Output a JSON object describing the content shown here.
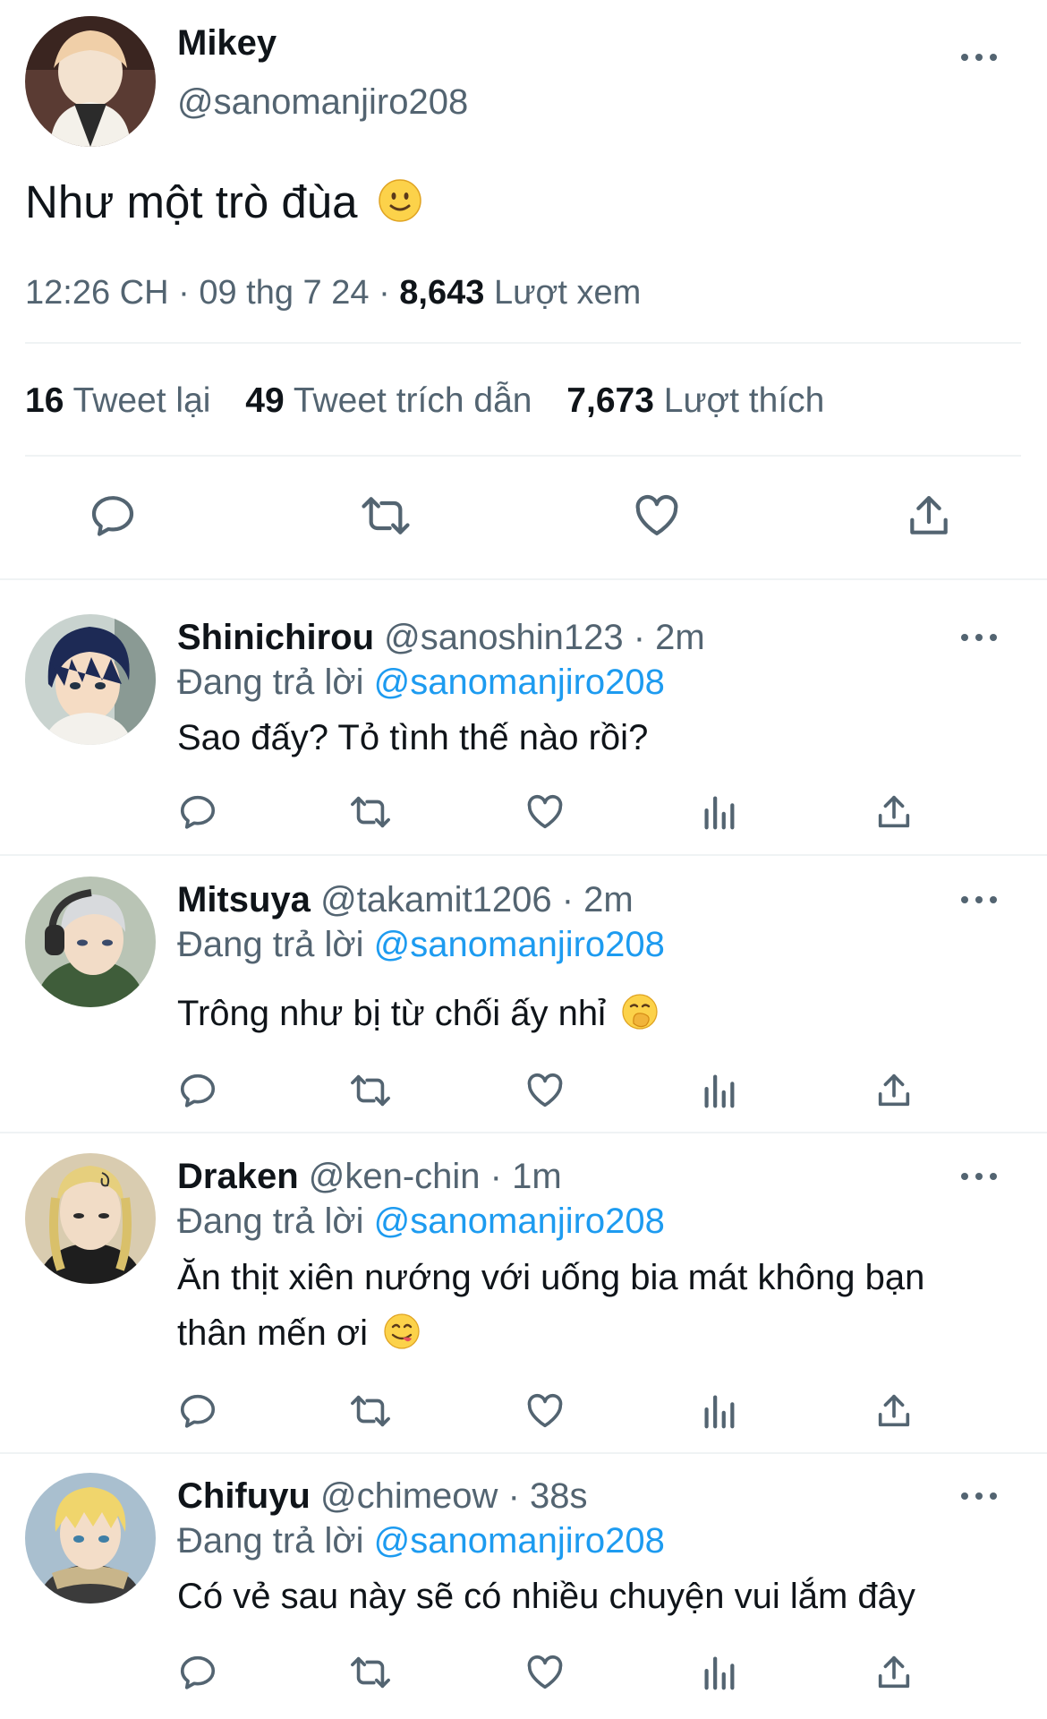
{
  "main_tweet": {
    "display_name": "Mikey",
    "handle": "@sanomanjiro208",
    "text": "Như một trò đùa",
    "time": "12:26 CH",
    "date": "09 thg 7 24",
    "views_count": "8,643",
    "views_label": "Lượt xem",
    "retweets_count": "16",
    "retweets_label": "Tweet lại",
    "quotes_count": "49",
    "quotes_label": "Tweet trích dẫn",
    "likes_count": "7,673",
    "likes_label": "Lượt thích"
  },
  "replies": [
    {
      "display_name": "Shinichirou",
      "handle": "@sanoshin123",
      "time": "2m",
      "replying_label": "Đang trả lời",
      "replying_to": "@sanomanjiro208",
      "text": "Sao đấy? Tỏ tình thế nào rồi?"
    },
    {
      "display_name": "Mitsuya",
      "handle": "@takamit1206",
      "time": "2m",
      "replying_label": "Đang trả lời",
      "replying_to": "@sanomanjiro208",
      "text": "Trông như bị từ chối ấy nhỉ"
    },
    {
      "display_name": "Draken",
      "handle": "@ken-chin",
      "time": "1m",
      "replying_label": "Đang trả lời",
      "replying_to": "@sanomanjiro208",
      "text_line1": "Ăn thịt xiên nướng với uống bia mát không bạn",
      "text_line2": "thân mến ơi"
    },
    {
      "display_name": "Chifuyu",
      "handle": "@chimeow",
      "time": "38s",
      "replying_label": "Đang trả lời",
      "replying_to": "@sanomanjiro208",
      "text": "Có vẻ sau này sẽ có nhiều chuyện vui lắm đây"
    }
  ],
  "separator": "·",
  "icons": [
    "more-icon",
    "reply-icon",
    "retweet-icon",
    "like-icon",
    "views-icon",
    "share-icon",
    "smile-emoji",
    "hand-over-mouth-emoji",
    "yum-emoji"
  ],
  "colors": {
    "text": "#0f1419",
    "secondary": "#536471",
    "link": "#1d9bf0",
    "divider": "#eff3f4"
  }
}
